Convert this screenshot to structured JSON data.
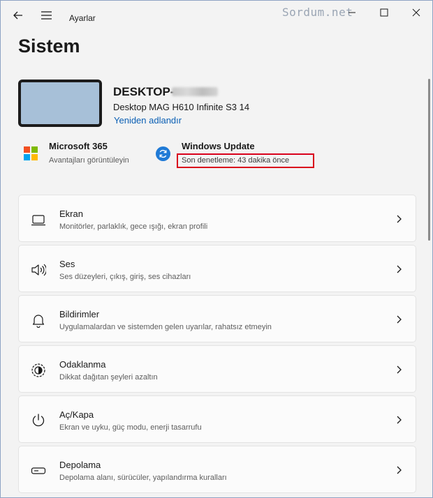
{
  "window": {
    "app_title": "Ayarlar",
    "watermark": "Sordum.net"
  },
  "page": {
    "title": "Sistem"
  },
  "device": {
    "name": "DESKTOP-",
    "model": "Desktop MAG H610 Infinite S3 14",
    "rename_label": "Yeniden adlandır"
  },
  "ms365": {
    "title": "Microsoft 365",
    "subtitle": "Avantajları görüntüleyin"
  },
  "windows_update": {
    "title": "Windows Update",
    "subtitle": "Son denetleme: 43 dakika önce",
    "highlight_color": "#d9001b"
  },
  "cards": [
    {
      "icon": "monitor-icon",
      "title": "Ekran",
      "subtitle": "Monitörler, parlaklık, gece ışığı, ekran profili"
    },
    {
      "icon": "speaker-icon",
      "title": "Ses",
      "subtitle": "Ses düzeyleri, çıkış, giriş, ses cihazları"
    },
    {
      "icon": "bell-icon",
      "title": "Bildirimler",
      "subtitle": "Uygulamalardan ve sistemden gelen uyarılar, rahatsız etmeyin"
    },
    {
      "icon": "focus-icon",
      "title": "Odaklanma",
      "subtitle": "Dikkat dağıtan şeyleri azaltın"
    },
    {
      "icon": "power-icon",
      "title": "Aç/Kapa",
      "subtitle": "Ekran ve uyku, güç modu, enerji tasarrufu"
    },
    {
      "icon": "storage-icon",
      "title": "Depolama",
      "subtitle": "Depolama alanı, sürücüler, yapılandırma kuralları"
    }
  ],
  "colors": {
    "accent": "#0a5fb4",
    "background": "#f3f3f3",
    "card": "#fbfbfb"
  }
}
